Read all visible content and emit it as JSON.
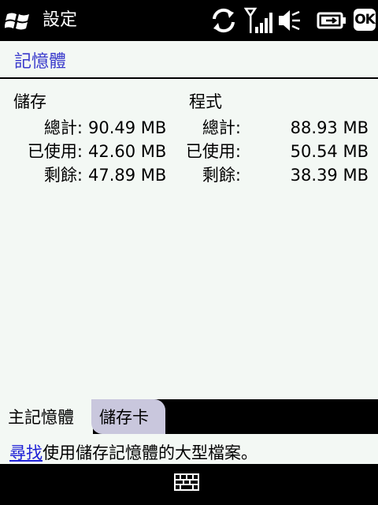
{
  "titlebar": {
    "title": "設定",
    "ok_label": "OK"
  },
  "icons": [
    "windows-start-icon",
    "sync-icon",
    "signal-icon",
    "volume-muted-icon",
    "battery-charging-icon",
    "keyboard-icon"
  ],
  "page": {
    "heading": "記憶體"
  },
  "storage": {
    "title": "儲存",
    "rows": [
      {
        "label": "總計:",
        "value": "90.49 MB"
      },
      {
        "label": "已使用:",
        "value": "42.60 MB"
      },
      {
        "label": "剩餘:",
        "value": "47.89 MB"
      }
    ]
  },
  "program": {
    "title": "程式",
    "rows": [
      {
        "label": "總計:",
        "value": "88.93 MB"
      },
      {
        "label": "已使用:",
        "value": "50.54 MB"
      },
      {
        "label": "剩餘:",
        "value": "38.39 MB"
      }
    ]
  },
  "tabs": [
    {
      "label": "主記憶體",
      "selected": true
    },
    {
      "label": "儲存卡",
      "selected": false
    }
  ],
  "hint": {
    "link_text": "尋找",
    "rest_text": "使用儲存記憶體的大型檔案。"
  },
  "colors": {
    "heading": "#3a3acc",
    "link": "#1f22d6",
    "background": "#f3f8f4",
    "tab_inactive": "#c9c7dd"
  }
}
